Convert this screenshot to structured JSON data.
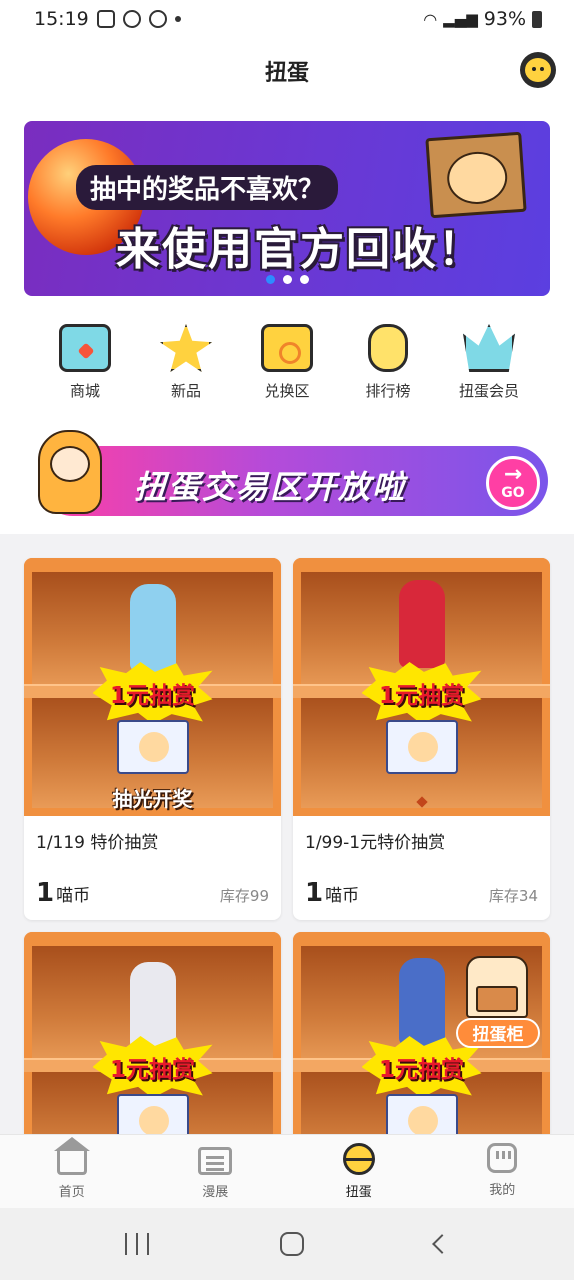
{
  "status_bar": {
    "time": "15:19",
    "battery": "93%"
  },
  "header": {
    "title": "扭蛋"
  },
  "banner": {
    "line1": "抽中的奖品不喜欢？",
    "line2": "来使用官方回收！",
    "slide_count": 3,
    "active_slide": 1
  },
  "quick_nav": [
    {
      "label": "商城",
      "icon": "shop-box-icon"
    },
    {
      "label": "新品",
      "icon": "new-star-icon"
    },
    {
      "label": "兑换区",
      "icon": "exchange-box-icon"
    },
    {
      "label": "排行榜",
      "icon": "ranking-icon"
    },
    {
      "label": "扭蛋会员",
      "icon": "vip-crown-icon"
    }
  ],
  "promo": {
    "text": "扭蛋交易区开放啦",
    "go_label": "GO"
  },
  "products": [
    {
      "title": "1/119 特价抽赏",
      "price": "1",
      "unit": "喵币",
      "stock": "库存99",
      "burst": "1元抽赏",
      "caption": "抽光开奖"
    },
    {
      "title": "1/99-1元特价抽赏",
      "price": "1",
      "unit": "喵币",
      "stock": "库存34",
      "burst": "1元抽赏",
      "caption": ""
    },
    {
      "title": "",
      "price": "",
      "unit": "",
      "stock": "",
      "burst": "1元抽赏",
      "caption": ""
    },
    {
      "title": "",
      "price": "",
      "unit": "",
      "stock": "",
      "burst": "1元抽赏",
      "caption": ""
    }
  ],
  "floating_cabinet": {
    "label": "扭蛋柜"
  },
  "tabbar": [
    {
      "label": "首页",
      "icon": "home-icon",
      "active": false
    },
    {
      "label": "漫展",
      "icon": "expo-icon",
      "active": false
    },
    {
      "label": "扭蛋",
      "icon": "gacha-icon",
      "active": true
    },
    {
      "label": "我的",
      "icon": "profile-icon",
      "active": false
    }
  ],
  "colors": {
    "accent": "#ffd23f",
    "banner": "#6a38d4",
    "promo": "#ff3fa4",
    "price_text": "#222222",
    "burst": "#ffe600",
    "burst_text": "#e8192c"
  }
}
